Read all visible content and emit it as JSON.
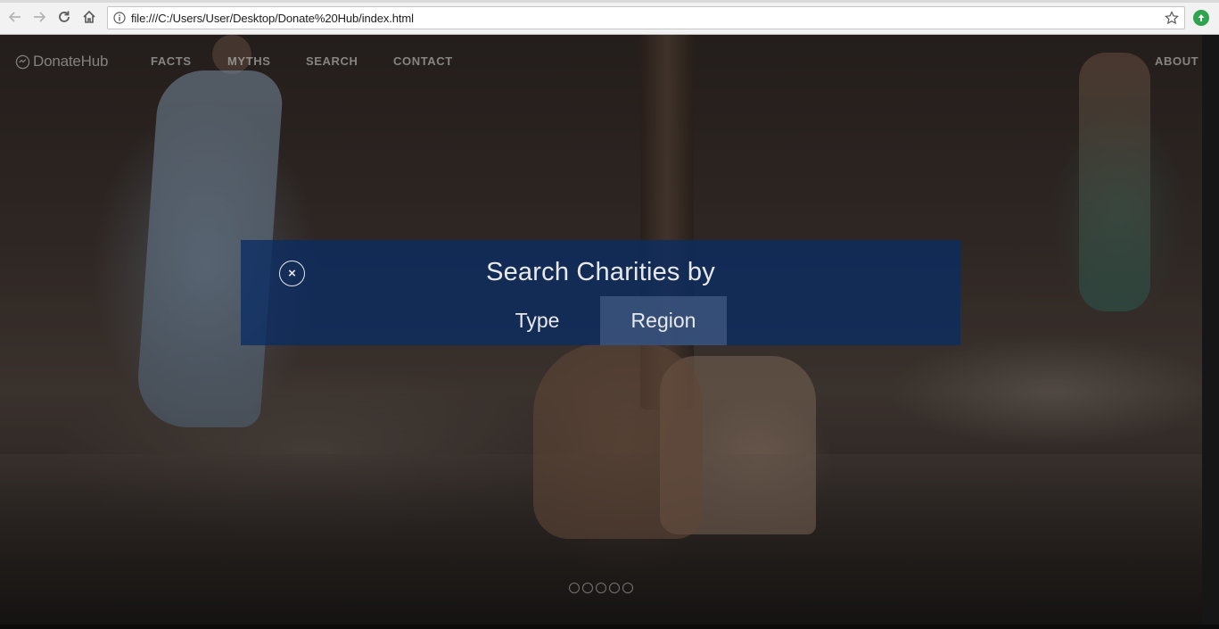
{
  "browser": {
    "url": "file:///C:/Users/User/Desktop/Donate%20Hub/index.html",
    "icons": [
      "back-arrow-icon",
      "forward-arrow-icon",
      "reload-icon",
      "home-icon",
      "info-icon",
      "bookmark-star-icon",
      "extension-icon"
    ]
  },
  "site": {
    "logo_text": "DonateHub",
    "nav": {
      "facts": "FACTS",
      "myths": "MYTHS",
      "search": "SEARCH",
      "contact": "CONTACT",
      "about": "ABOUT"
    }
  },
  "modal": {
    "close_symbol": "×",
    "title": "Search Charities by",
    "options": {
      "type": "Type",
      "region": "Region"
    },
    "selected": "Region",
    "accent_color": "#0a2d64"
  },
  "carousel": {
    "slide_count": 5
  }
}
